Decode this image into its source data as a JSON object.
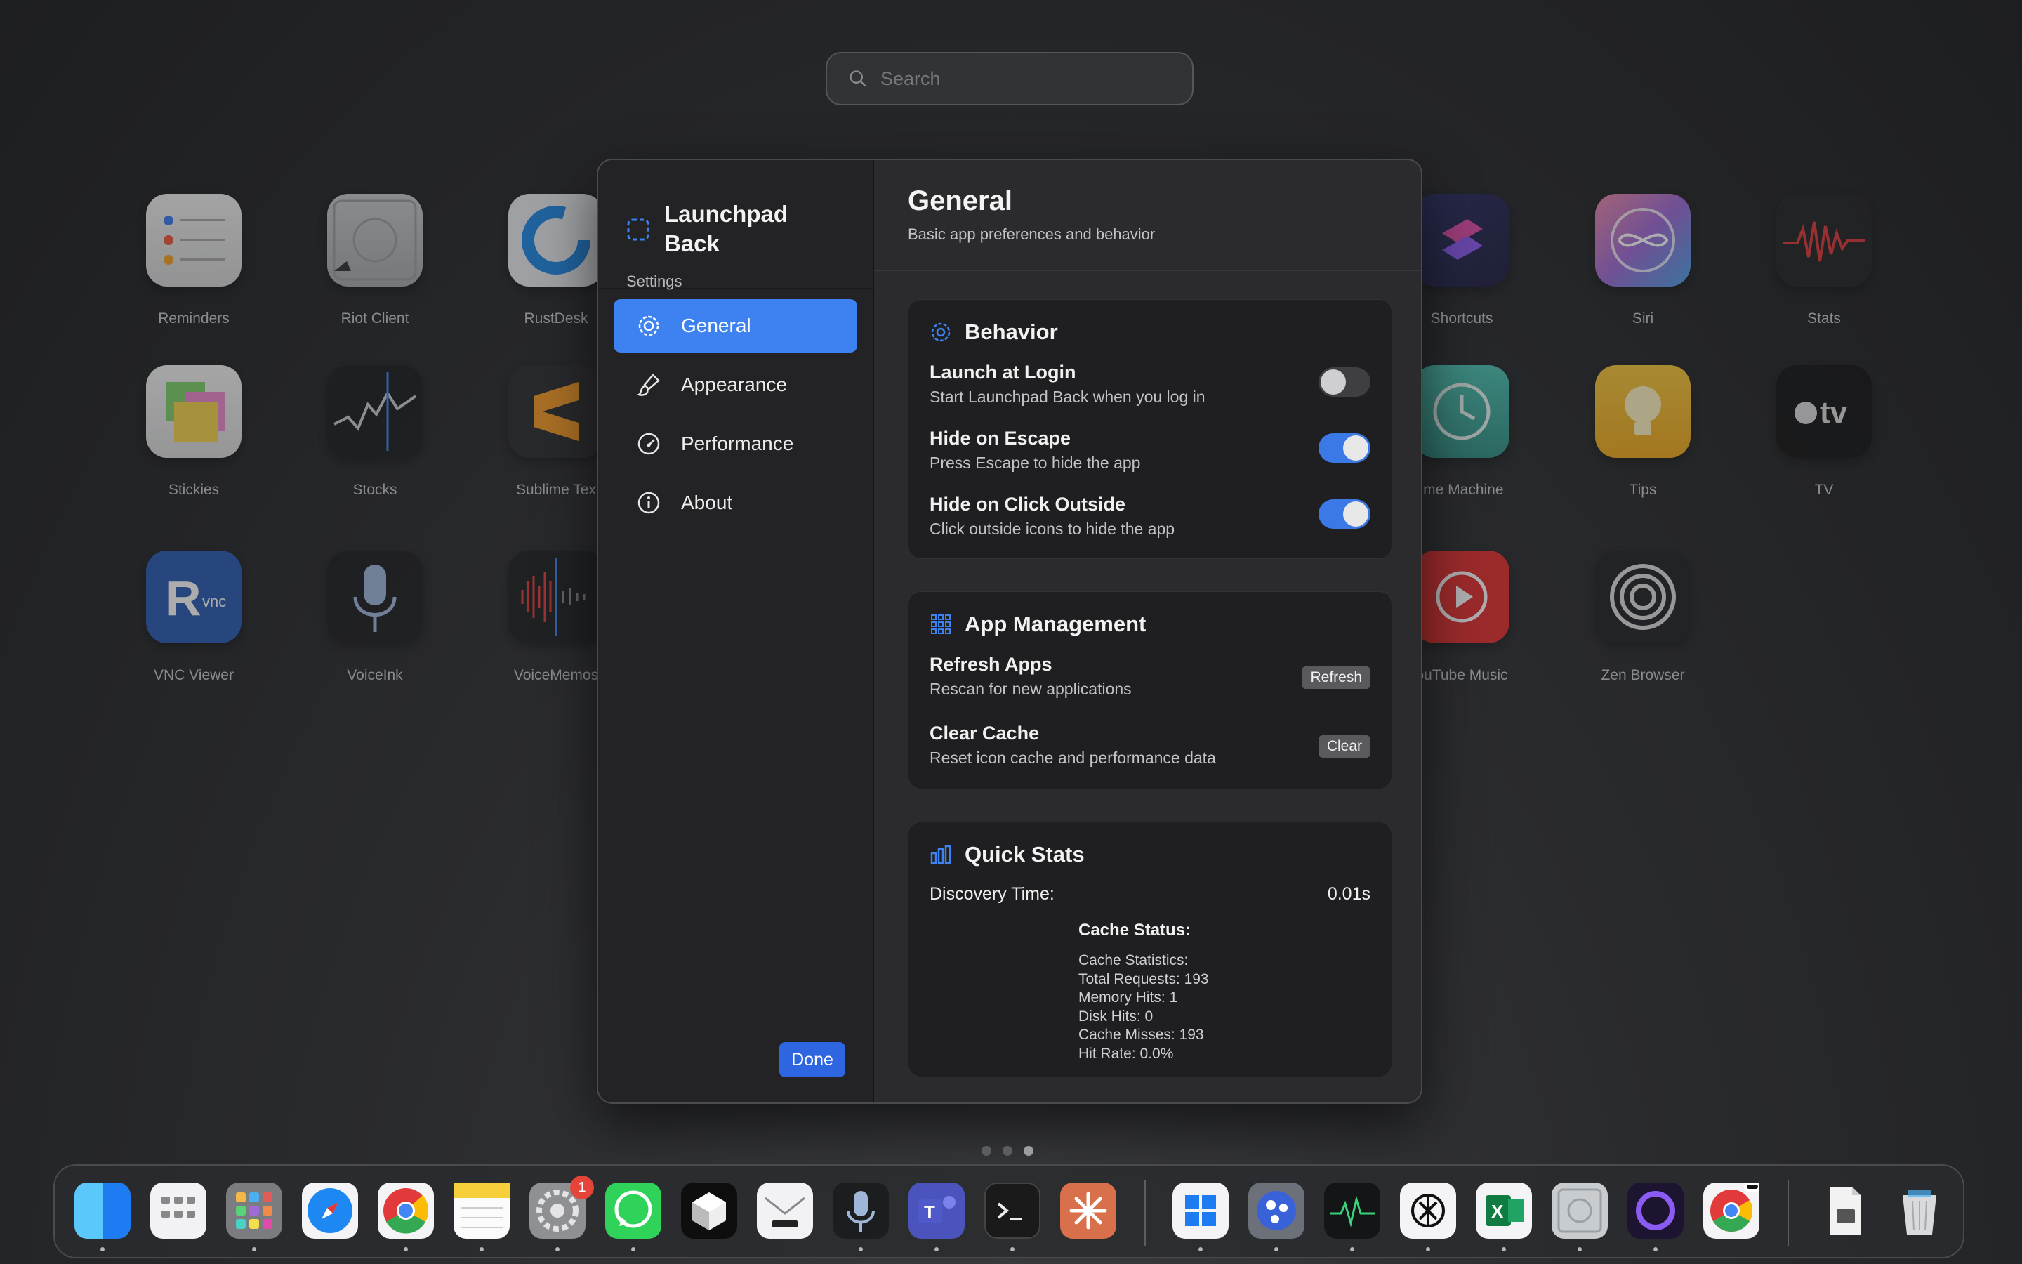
{
  "search": {
    "placeholder": "Search"
  },
  "launchpad_apps": [
    {
      "label": "Reminders"
    },
    {
      "label": "Riot Client"
    },
    {
      "label": "RustDesk"
    },
    {
      "label": "Shortcuts"
    },
    {
      "label": "Siri"
    },
    {
      "label": "Stats"
    },
    {
      "label": "Stickies"
    },
    {
      "label": "Stocks"
    },
    {
      "label": "Sublime Tex"
    },
    {
      "label": "ime Machine"
    },
    {
      "label": "Tips"
    },
    {
      "label": "TV"
    },
    {
      "label": "VNC Viewer"
    },
    {
      "label": "VoiceInk"
    },
    {
      "label": "VoiceMemos"
    },
    {
      "label": "ouTube Music"
    },
    {
      "label": "Zen Browser"
    }
  ],
  "sidebar": {
    "app_title": "Launchpad Back",
    "subtitle": "Settings",
    "items": [
      {
        "label": "General",
        "icon": "gear-icon",
        "active": true
      },
      {
        "label": "Appearance",
        "icon": "paintbrush-icon",
        "active": false
      },
      {
        "label": "Performance",
        "icon": "speedometer-icon",
        "active": false
      },
      {
        "label": "About",
        "icon": "info-icon",
        "active": false
      }
    ],
    "done_label": "Done"
  },
  "main": {
    "title": "General",
    "subtitle": "Basic app preferences and behavior"
  },
  "behavior": {
    "title": "Behavior",
    "rows": [
      {
        "title": "Launch at Login",
        "desc": "Start Launchpad Back when you log in",
        "enabled": false
      },
      {
        "title": "Hide on Escape",
        "desc": "Press Escape to hide the app",
        "enabled": true
      },
      {
        "title": "Hide on Click Outside",
        "desc": "Click outside icons to hide the app",
        "enabled": true
      }
    ]
  },
  "app_management": {
    "title": "App Management",
    "rows": [
      {
        "title": "Refresh Apps",
        "desc": "Rescan for new applications",
        "button": "Refresh"
      },
      {
        "title": "Clear Cache",
        "desc": "Reset icon cache and performance data",
        "button": "Clear"
      }
    ]
  },
  "quick_stats": {
    "title": "Quick Stats",
    "discovery_label": "Discovery Time:",
    "discovery_value": "0.01s",
    "cache_status_label": "Cache Status:",
    "cache_lines": [
      "Cache Statistics:",
      "Total Requests: 193",
      "Memory Hits: 1",
      "Disk Hits: 0",
      "Cache Misses: 193",
      "Hit Rate: 0.0%"
    ]
  },
  "dock": {
    "settings_badge": "1",
    "accent": "#3d82f0"
  }
}
